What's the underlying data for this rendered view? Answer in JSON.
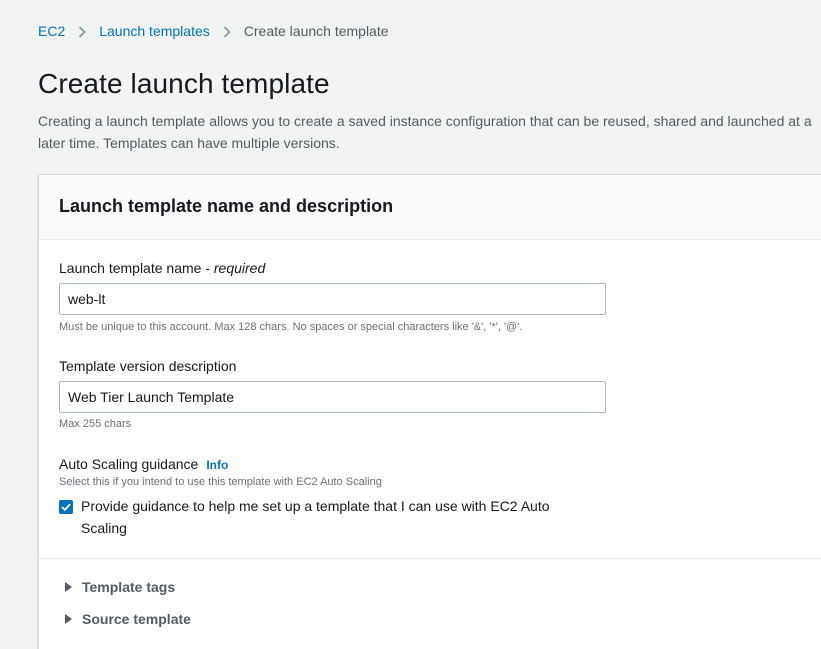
{
  "breadcrumb": {
    "items": [
      "EC2",
      "Launch templates"
    ],
    "current": "Create launch template"
  },
  "header": {
    "title": "Create launch template",
    "description": "Creating a launch template allows you to create a saved instance configuration that can be reused, shared and launched at a later time. Templates can have multiple versions."
  },
  "panel": {
    "title": "Launch template name and description",
    "name_field": {
      "label": "Launch template name - ",
      "required": "required",
      "value": "web-lt",
      "hint": "Must be unique to this account. Max 128 chars. No spaces or special characters like '&', '*', '@'."
    },
    "description_field": {
      "label": "Template version description",
      "value": "Web Tier Launch Template",
      "hint": "Max 255 chars"
    },
    "autoscaling": {
      "label": "Auto Scaling guidance",
      "info": "Info",
      "hint": "Select this if you intend to use this template with EC2 Auto Scaling",
      "checkbox_label": "Provide guidance to help me set up a template that I can use with EC2 Auto Scaling",
      "checked": true
    },
    "expanders": [
      "Template tags",
      "Source template"
    ]
  },
  "colors": {
    "link": "#0073bb",
    "accent": "#0073bb",
    "background": "#f2f3f3"
  }
}
